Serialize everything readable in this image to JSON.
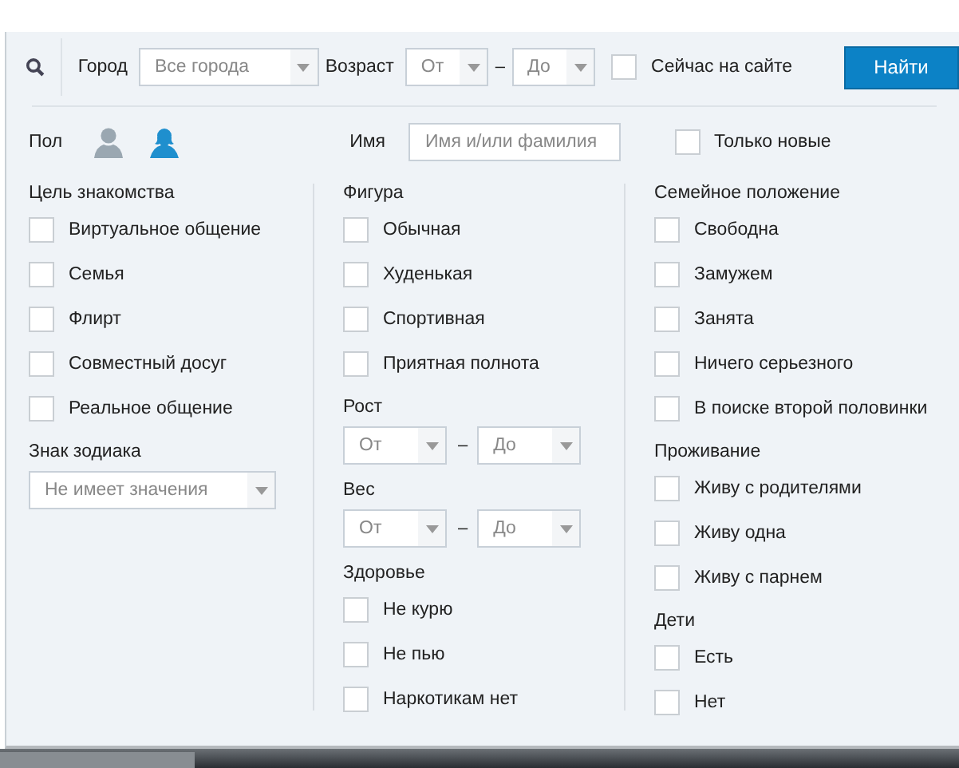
{
  "search": {
    "city": {
      "label": "Город",
      "placeholder": "Все города"
    },
    "age": {
      "label": "Возраст",
      "from": "От",
      "dash": "–",
      "to": "До"
    },
    "online": {
      "label": "Сейчас на сайте",
      "checked": false
    },
    "button": "Найти"
  },
  "filters": {
    "gender": {
      "label": "Пол",
      "options": [
        {
          "kind": "male",
          "selected": false
        },
        {
          "kind": "female",
          "selected": true
        }
      ]
    },
    "name": {
      "label": "Имя",
      "placeholder": "Имя и/или фамилия"
    },
    "only_new": {
      "label": "Только новые",
      "checked": false
    }
  },
  "columns": [
    {
      "sections": [
        {
          "kind": "checkboxes",
          "title": "Цель знакомства",
          "items": [
            {
              "label": "Виртуальное общение",
              "checked": false
            },
            {
              "label": "Семья",
              "checked": false
            },
            {
              "label": "Флирт",
              "checked": false
            },
            {
              "label": "Совместный досуг",
              "checked": false
            },
            {
              "label": "Реальное общение",
              "checked": false
            }
          ]
        },
        {
          "kind": "select",
          "title": "Знак зодиака",
          "placeholder": "Не имеет значения"
        }
      ]
    },
    {
      "sections": [
        {
          "kind": "checkboxes",
          "title": "Фигура",
          "items": [
            {
              "label": "Обычная",
              "checked": false
            },
            {
              "label": "Худенькая",
              "checked": false
            },
            {
              "label": "Спортивная",
              "checked": false
            },
            {
              "label": "Приятная полнота",
              "checked": false
            }
          ]
        },
        {
          "kind": "range",
          "title": "Рост",
          "from": "От",
          "dash": "–",
          "to": "До"
        },
        {
          "kind": "range",
          "title": "Вес",
          "from": "От",
          "dash": "–",
          "to": "До"
        },
        {
          "kind": "checkboxes",
          "title": "Здоровье",
          "items": [
            {
              "label": "Не курю",
              "checked": false
            },
            {
              "label": "Не пью",
              "checked": false
            },
            {
              "label": "Наркотикам нет",
              "checked": false
            }
          ]
        }
      ]
    },
    {
      "sections": [
        {
          "kind": "checkboxes",
          "title": "Семейное положение",
          "items": [
            {
              "label": "Свободна",
              "checked": false
            },
            {
              "label": "Замужем",
              "checked": false
            },
            {
              "label": "Занята",
              "checked": false
            },
            {
              "label": "Ничего серьезного",
              "checked": false
            },
            {
              "label": "В поиске второй половинки",
              "checked": false
            }
          ]
        },
        {
          "kind": "checkboxes",
          "title": "Проживание",
          "items": [
            {
              "label": "Живу с родителями",
              "checked": false
            },
            {
              "label": "Живу одна",
              "checked": false
            },
            {
              "label": "Живу с парнем",
              "checked": false
            }
          ]
        },
        {
          "kind": "checkboxes",
          "title": "Дети",
          "items": [
            {
              "label": "Есть",
              "checked": false
            },
            {
              "label": "Нет",
              "checked": false
            }
          ]
        }
      ]
    }
  ]
}
